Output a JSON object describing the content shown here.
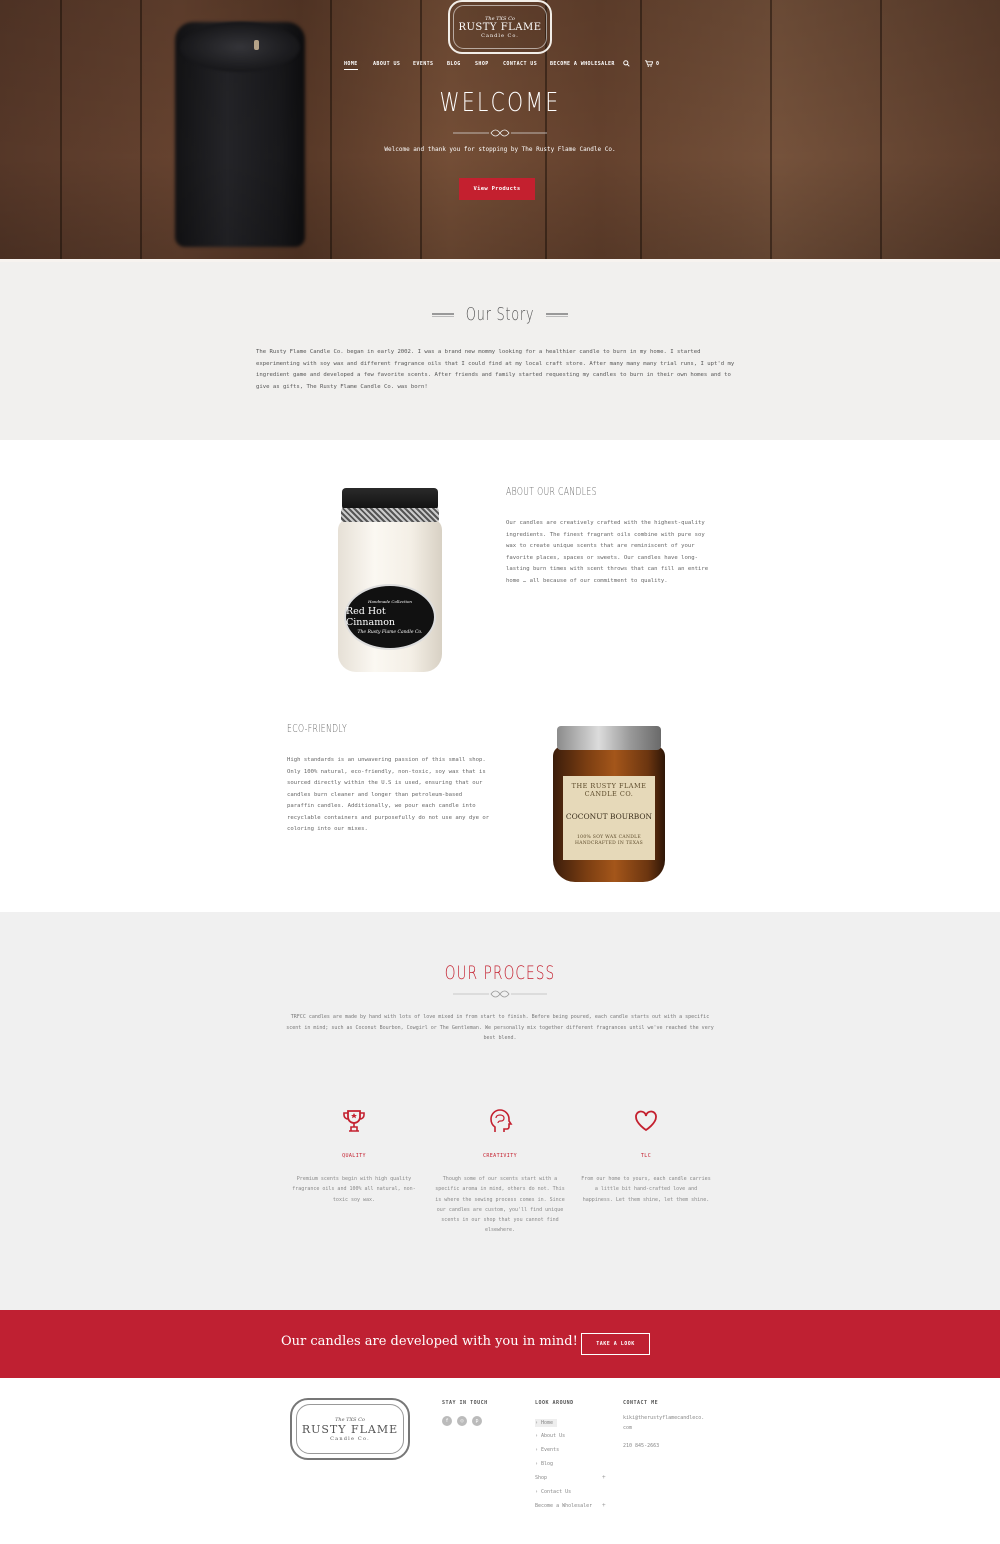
{
  "brand": {
    "logo_small": "The TXS Co",
    "logo_main": "RUSTY FLAME",
    "logo_sub": "Candle Co."
  },
  "nav": {
    "items": [
      "HOME",
      "ABOUT US",
      "EVENTS",
      "BLOG",
      "SHOP",
      "CONTACT US",
      "BECOME A WHOLESALER"
    ],
    "cart_count": "0"
  },
  "hero": {
    "title": "WELCOME",
    "subtitle": "Welcome and thank you for stopping by The Rusty Flame Candle Co.",
    "button": "View Products"
  },
  "story": {
    "title": "Our Story",
    "text": "The Rusty Flame Candle Co. began in early 2002.  I was a brand new mommy looking for a healthier candle to burn in my home.  I started experimenting with soy wax and different fragrance oils that I could find at my local craft store. After many many many trial runs, I upt'd my ingredient game and developed a few favorite scents.  After friends and family started requesting my candles to burn in their own homes and to give as gifts, The Rusty Flame Candle Co. was born!"
  },
  "about": {
    "title": "ABOUT OUR CANDLES",
    "text": "Our candles are creatively crafted with the highest-quality ingredients. The finest fragrant oils combine with pure soy wax to create unique scents that are reminiscent of your favorite places, spaces or sweets. Our candles have long-lasting burn times with scent throws that can fill an entire home … all because of our commitment to quality.",
    "jar_label_top": "Handmade Collection",
    "jar_label_name": "Red Hot Cinnamon",
    "jar_label_bottom": "The Rusty Flame Candle Co."
  },
  "eco": {
    "title": "ECO-FRIENDLY",
    "text": "High standards is an unwavering passion of this small shop. Only 100% natural, eco-friendly, non-toxic, soy wax that is sourced directly within the U.S is used, ensuring that our candles burn cleaner and longer than petroleum-based paraffin candles. Additionally, we pour each candle into recyclable containers and purposefully do not use any dye or coloring into our mixes.",
    "jar_label_brand": "THE RUSTY FLAME CANDLE CO.",
    "jar_label_name": "COCONUT BOURBON",
    "jar_label_bottom": "100% SOY WAX CANDLE HANDCRAFTED IN TEXAS"
  },
  "process": {
    "title": "OUR PROCESS",
    "text": "TRFCC candles are made by hand with lots of love mixed in from start to finish. Before being poured, each candle starts out with a specific scent in mind; such as Coconut Bourbon, Cowgirl or The Gentleman. We personally mix together different fragrances until we've reached the very best blend.",
    "features": [
      {
        "icon": "trophy-icon",
        "title": "QUALITY",
        "text": "Premium scents begin with high quality fragrance oils and 100% all natural, non-toxic soy wax."
      },
      {
        "icon": "brain-head-icon",
        "title": "CREATIVITY",
        "text": "Though some of our scents start with a specific aroma in mind, others do not. This is where the sewing process comes in. Since our candles are custom, you'll find unique scents in our shop that you cannot find elsewhere."
      },
      {
        "icon": "heart-icon",
        "title": "TLC",
        "text": "From our home to yours, each candle carries a little bit hand-crafted love and happiness. Let them shine, let them shine."
      }
    ],
    "accent_color": "#c4202f"
  },
  "cta": {
    "text": "Our candles are developed with you in mind!",
    "button": "TAKE A LOOK",
    "background": "#bf2032"
  },
  "footer": {
    "stay_in_touch": "STAY IN TOUCH",
    "social": [
      "facebook-icon",
      "instagram-icon",
      "pinterest-icon"
    ],
    "look_around": "LOOK AROUND",
    "links": [
      "› Home",
      "› About Us",
      "› Events",
      "› Blog",
      "Shop",
      "› Contact Us",
      "Become a Wholesaler"
    ],
    "contact_us": "CONTACT ME",
    "email": "kiki@therustyflamecandleco.com",
    "phone": "210 845-2663"
  }
}
